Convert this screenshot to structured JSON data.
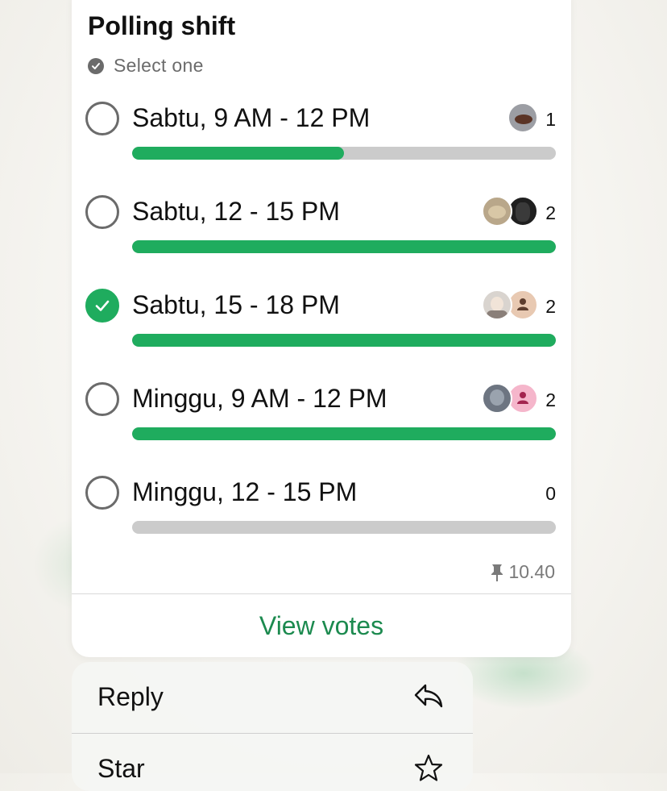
{
  "poll": {
    "title": "Polling shift",
    "subtitle": "Select one",
    "options": [
      {
        "label": "Sabtu, 9 AM - 12 PM",
        "votes": "1",
        "fill": 0.5,
        "selected": false
      },
      {
        "label": "Sabtu, 12 - 15 PM",
        "votes": "2",
        "fill": 1.0,
        "selected": false
      },
      {
        "label": "Sabtu, 15 - 18 PM",
        "votes": "2",
        "fill": 1.0,
        "selected": true
      },
      {
        "label": "Minggu, 9 AM - 12 PM",
        "votes": "2",
        "fill": 1.0,
        "selected": false
      },
      {
        "label": "Minggu, 12 - 15 PM",
        "votes": "0",
        "fill": 0.0,
        "selected": false
      }
    ],
    "time": "10.40",
    "view_votes": "View votes"
  },
  "menu": {
    "items": [
      {
        "label": "Reply",
        "icon": "reply-icon"
      },
      {
        "label": "Star",
        "icon": "star-icon"
      }
    ]
  },
  "colors": {
    "accent": "#1fac5e",
    "link": "#1c8a4f",
    "track": "#cbcbcb"
  }
}
